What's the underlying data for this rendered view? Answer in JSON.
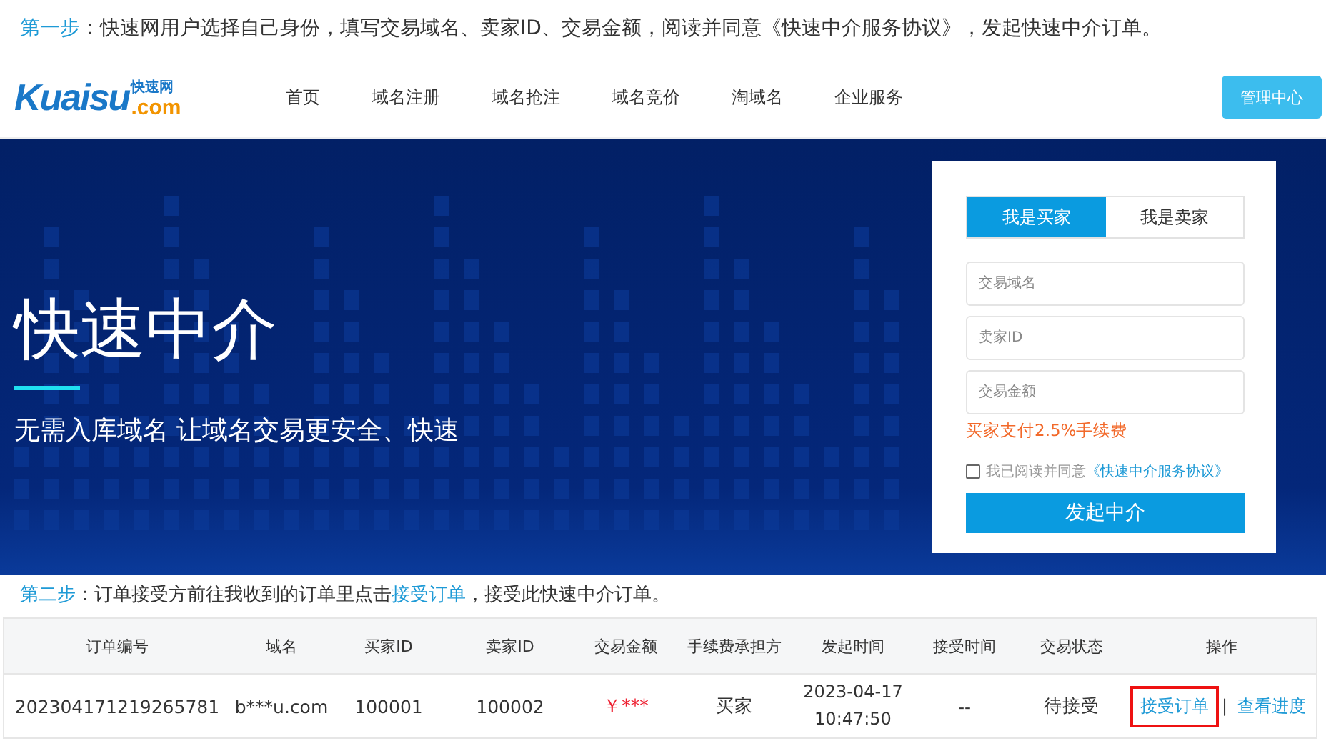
{
  "step1": {
    "label": "第一步",
    "text": "：快速网用户选择自己身份，填写交易域名、卖家ID、交易金额，阅读并同意《快速中介服务协议》，发起快速中介订单。"
  },
  "header": {
    "logo": {
      "main": "Kuaisu",
      "cn": "快速网",
      "suffix": ".com"
    },
    "nav": [
      {
        "label": "首页"
      },
      {
        "label": "域名注册"
      },
      {
        "label": "域名抢注"
      },
      {
        "label": "域名竞价"
      },
      {
        "label": "淘域名"
      },
      {
        "label": "企业服务"
      }
    ],
    "admin_button": "管理中心"
  },
  "banner": {
    "title": "快速中介",
    "subtitle": "无需入库域名 让域名交易更安全、快速"
  },
  "form": {
    "tabs": [
      {
        "label": "我是买家",
        "selected": true
      },
      {
        "label": "我是卖家",
        "selected": false
      }
    ],
    "fields": [
      {
        "placeholder": "交易域名"
      },
      {
        "placeholder": "卖家ID"
      },
      {
        "placeholder": "交易金额"
      }
    ],
    "fee_note": "买家支付2.5%手续费",
    "agreement": {
      "checked": false,
      "text": "我已阅读并同意",
      "link": "《快速中介服务协议》"
    },
    "submit": "发起中介"
  },
  "step2": {
    "label": "第二步",
    "before": "：订单接受方前往我收到的订单里点击",
    "link": "接受订单",
    "after": "，接受此快速中介订单。"
  },
  "table": {
    "columns": [
      "订单编号",
      "域名",
      "买家ID",
      "卖家ID",
      "交易金额",
      "手续费承担方",
      "发起时间",
      "接受时间",
      "交易状态",
      "操作"
    ],
    "rows": [
      {
        "cells": [
          "202304171219265781",
          "b***u.com",
          "100001",
          "100002",
          "￥***",
          "买家",
          "2023-04-17 10:47:50",
          "--",
          "待接受"
        ],
        "actions": [
          {
            "label": "接受订单",
            "highlighted": true
          },
          {
            "label": "查看进度",
            "highlighted": false
          }
        ],
        "separator": "|"
      }
    ]
  }
}
